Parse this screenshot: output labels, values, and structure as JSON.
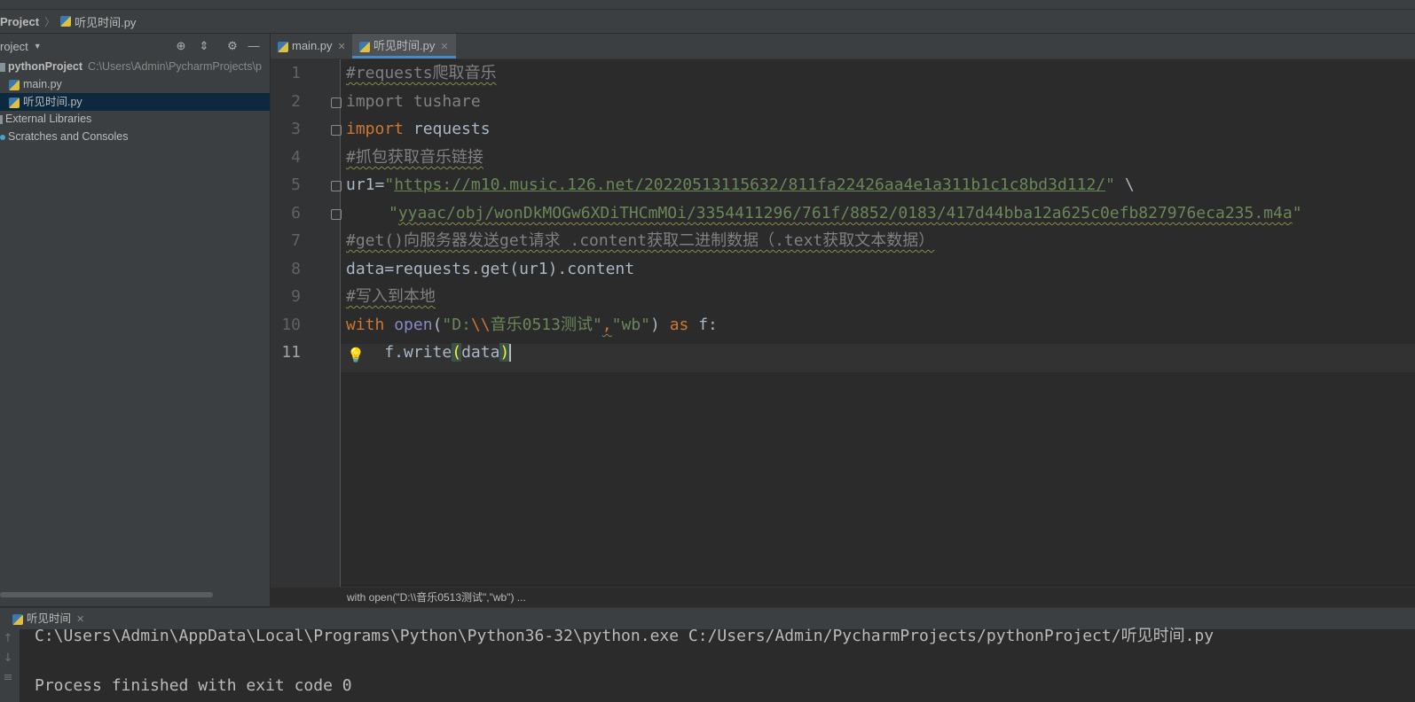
{
  "navbar": {
    "project": "Project",
    "file": "听见时间.py"
  },
  "project_panel": {
    "title": "roject",
    "tree": {
      "root_name": "pythonProject",
      "root_path": "C:\\Users\\Admin\\PycharmProjects\\p",
      "files": [
        "main.py",
        "听见时间.py"
      ],
      "external": "External Libraries",
      "scratches": "Scratches and Consoles"
    }
  },
  "editor": {
    "tabs": [
      {
        "label": "main.py",
        "active": false
      },
      {
        "label": "听见时间.py",
        "active": true
      }
    ],
    "line_numbers": [
      "1",
      "2",
      "3",
      "4",
      "5",
      "6",
      "7",
      "8",
      "9",
      "10",
      "11"
    ],
    "current_line": 11,
    "code": {
      "l1": "#requests爬取音乐",
      "l2_kw": "import",
      "l2_rest": " tushare",
      "l3_kw": "import",
      "l3_rest": " requests",
      "l4": "#抓包获取音乐链接",
      "l5_a": "ur1=",
      "l5_q1": "\"",
      "l5_link": "https://m10.music.126.net/20220513115632/811fa22426aa4e1a311b1c1c8bd3d112/",
      "l5_q2": "\"",
      "l5_tail": " \\",
      "l6_q1": "\"",
      "l6_link": "yyaac/obj/wonDkMOGw6XDiTHCmMOi/3354411296/761f/8852/0183/417d44bba12a625c0efb827976eca235.m4a",
      "l6_q2": "\"",
      "l7": "#get()向服务器发送get请求 .content获取二进制数据（.text获取文本数据）",
      "l8": "data=requests.get(ur1).content",
      "l9": "#写入到本地",
      "l10_with": "with",
      "l10_open": "open",
      "l10_p1": "(",
      "l10_s1a": "\"D:",
      "l10_esc": "\\\\",
      "l10_s1b": "音乐0513测试\"",
      "l10_comma": ",",
      "l10_s2": "\"wb\"",
      "l10_p2": ")",
      "l10_as": "as",
      "l10_f": " f:",
      "l11_a": "    f.write",
      "l11_p1": "(",
      "l11_b": "data",
      "l11_p2": ")"
    }
  },
  "breadcrumb": "with open(\"D:\\\\音乐0513测试\",\"wb\") ...",
  "run": {
    "tab": "听见时间",
    "lines": [
      "C:\\Users\\Admin\\AppData\\Local\\Programs\\Python\\Python36-32\\python.exe C:/Users/Admin/PycharmProjects/pythonProject/听见时间.py",
      "",
      "Process finished with exit code 0"
    ]
  }
}
